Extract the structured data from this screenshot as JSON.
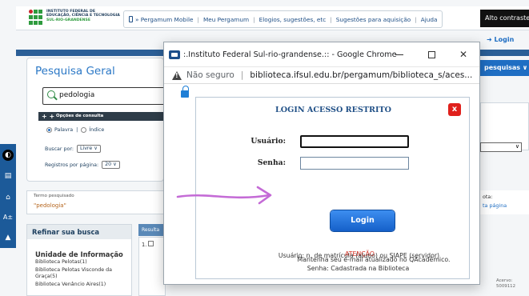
{
  "header": {
    "logo_line1": "INSTITUTO FEDERAL DE",
    "logo_line2": "EDUCAÇÃO, CIÊNCIA E TECNOLOGIA",
    "logo_line3": "SUL-RIO-GRANDENSE",
    "nav": [
      "» Pergamum Mobile",
      "Meu Pergamum",
      "Elogios, sugestões, etc",
      "Sugestões para aquisição",
      "Ajuda"
    ],
    "contrast_label": "Alto contraste",
    "login_link": "Login",
    "pesquisas_label": "pesquisas"
  },
  "search": {
    "title": "Pesquisa Geral",
    "query": "pedologia",
    "options_label": "Opções de consulta",
    "radio_palavra": "Palavra",
    "radio_indice": "Índice",
    "buscar_label": "Buscar por:",
    "buscar_value": "Livre",
    "registros_label": "Registros por página:",
    "registros_value": "20"
  },
  "termo": {
    "label": "Termo pesquisado",
    "value": "\"pedologia\""
  },
  "refine": {
    "header": "Refinar sua busca",
    "group_title": "Unidade de Informação",
    "items": [
      "Biblioteca Pelotas(1)",
      "Biblioteca Pelotas Visconde da Graça(5)",
      "Biblioteca Venâncio Aires(1)"
    ]
  },
  "results": {
    "tab_label": "Resulta",
    "row_index": "1."
  },
  "right": {
    "card_label": "ota:",
    "card_link": "ta página",
    "acervo_label": "Acervo:",
    "acervo_value": "5009112"
  },
  "popup": {
    "window_title": ":.Instituto Federal Sul-rio-grandense.:: - Google Chrome",
    "security_label": "Não seguro",
    "url": "biblioteca.ifsul.edu.br/pergamum/biblioteca_s/aces...",
    "login_title": "LOGIN ACESSO RESTRITO",
    "close_label": "x",
    "user_label": "Usuário:",
    "user_value": "",
    "pass_label": "Senha:",
    "pass_value": "",
    "login_button": "Login",
    "atencao": "ATENÇÃO",
    "info_user": "Usuário: n. de matrícula (aluno) ou SIAPE (servidor)",
    "info_pass": "Senha: Cadastrada na Biblioteca",
    "info_email": "Mantenha seu e-mail atualizado no QAcadêmico."
  },
  "colors": {
    "accent": "#1f6ec3",
    "brand_green": "#2e9b3e",
    "annotation_arrow": "#c46bd6",
    "warning_red": "#d42b1e"
  }
}
